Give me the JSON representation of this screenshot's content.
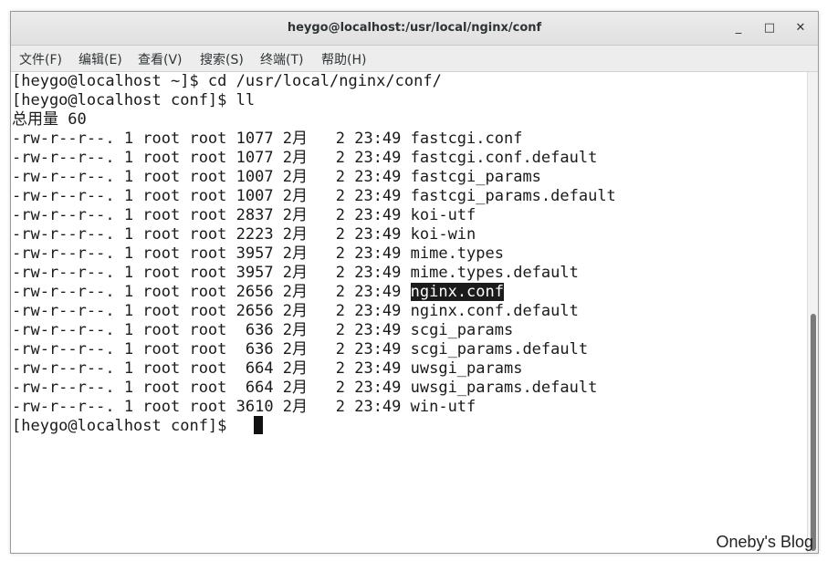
{
  "window": {
    "title": "heygo@localhost:/usr/local/nginx/conf",
    "minimize": "_",
    "maximize": "□",
    "close": "✕"
  },
  "menu": [
    "文件(F)",
    "编辑(E)",
    "查看(V)",
    "搜索(S)",
    "终端(T)",
    "帮助(H)"
  ],
  "terminal": {
    "lines": [
      "[heygo@localhost ~]$ cd /usr/local/nginx/conf/",
      "[heygo@localhost conf]$ ll",
      "总用量 60",
      "-rw-r--r--. 1 root root 1077 2月   2 23:49 fastcgi.conf",
      "-rw-r--r--. 1 root root 1077 2月   2 23:49 fastcgi.conf.default",
      "-rw-r--r--. 1 root root 1007 2月   2 23:49 fastcgi_params",
      "-rw-r--r--. 1 root root 1007 2月   2 23:49 fastcgi_params.default",
      "-rw-r--r--. 1 root root 2837 2月   2 23:49 koi-utf",
      "-rw-r--r--. 1 root root 2223 2月   2 23:49 koi-win",
      "-rw-r--r--. 1 root root 3957 2月   2 23:49 mime.types",
      "-rw-r--r--. 1 root root 3957 2月   2 23:49 mime.types.default",
      "-rw-r--r--. 1 root root 2656 2月   2 23:49 ",
      "-rw-r--r--. 1 root root 2656 2月   2 23:49 nginx.conf.default",
      "-rw-r--r--. 1 root root  636 2月   2 23:49 scgi_params",
      "-rw-r--r--. 1 root root  636 2月   2 23:49 scgi_params.default",
      "-rw-r--r--. 1 root root  664 2月   2 23:49 uwsgi_params",
      "-rw-r--r--. 1 root root  664 2月   2 23:49 uwsgi_params.default",
      "-rw-r--r--. 1 root root 3610 2月   2 23:49 win-utf",
      "[heygo@localhost conf]$ "
    ],
    "highlighted": "nginx.conf"
  },
  "watermark": "Oneby's Blog"
}
